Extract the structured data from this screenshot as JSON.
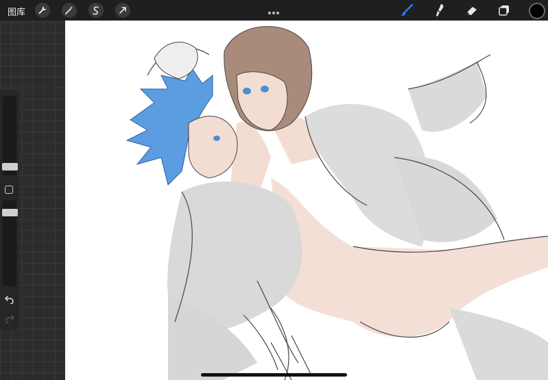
{
  "topbar": {
    "gallery_label": "图库",
    "left_tools": [
      "wrench-icon",
      "magic-wand-icon",
      "selection-icon",
      "transform-arrow-icon"
    ],
    "right_tools": [
      "brush-icon",
      "smudge-icon",
      "eraser-icon",
      "layers-icon"
    ],
    "more_icon": "ellipsis-icon",
    "active_tool": "brush",
    "accent_color": "#2a7fff",
    "current_color": "#000000"
  },
  "sidebar": {
    "size_slider_level": 0.55,
    "opacity_slider_level": 0.35,
    "icons": [
      "modify-square-icon",
      "undo-icon",
      "redo-icon"
    ]
  },
  "canvas": {
    "content": "artwork"
  }
}
